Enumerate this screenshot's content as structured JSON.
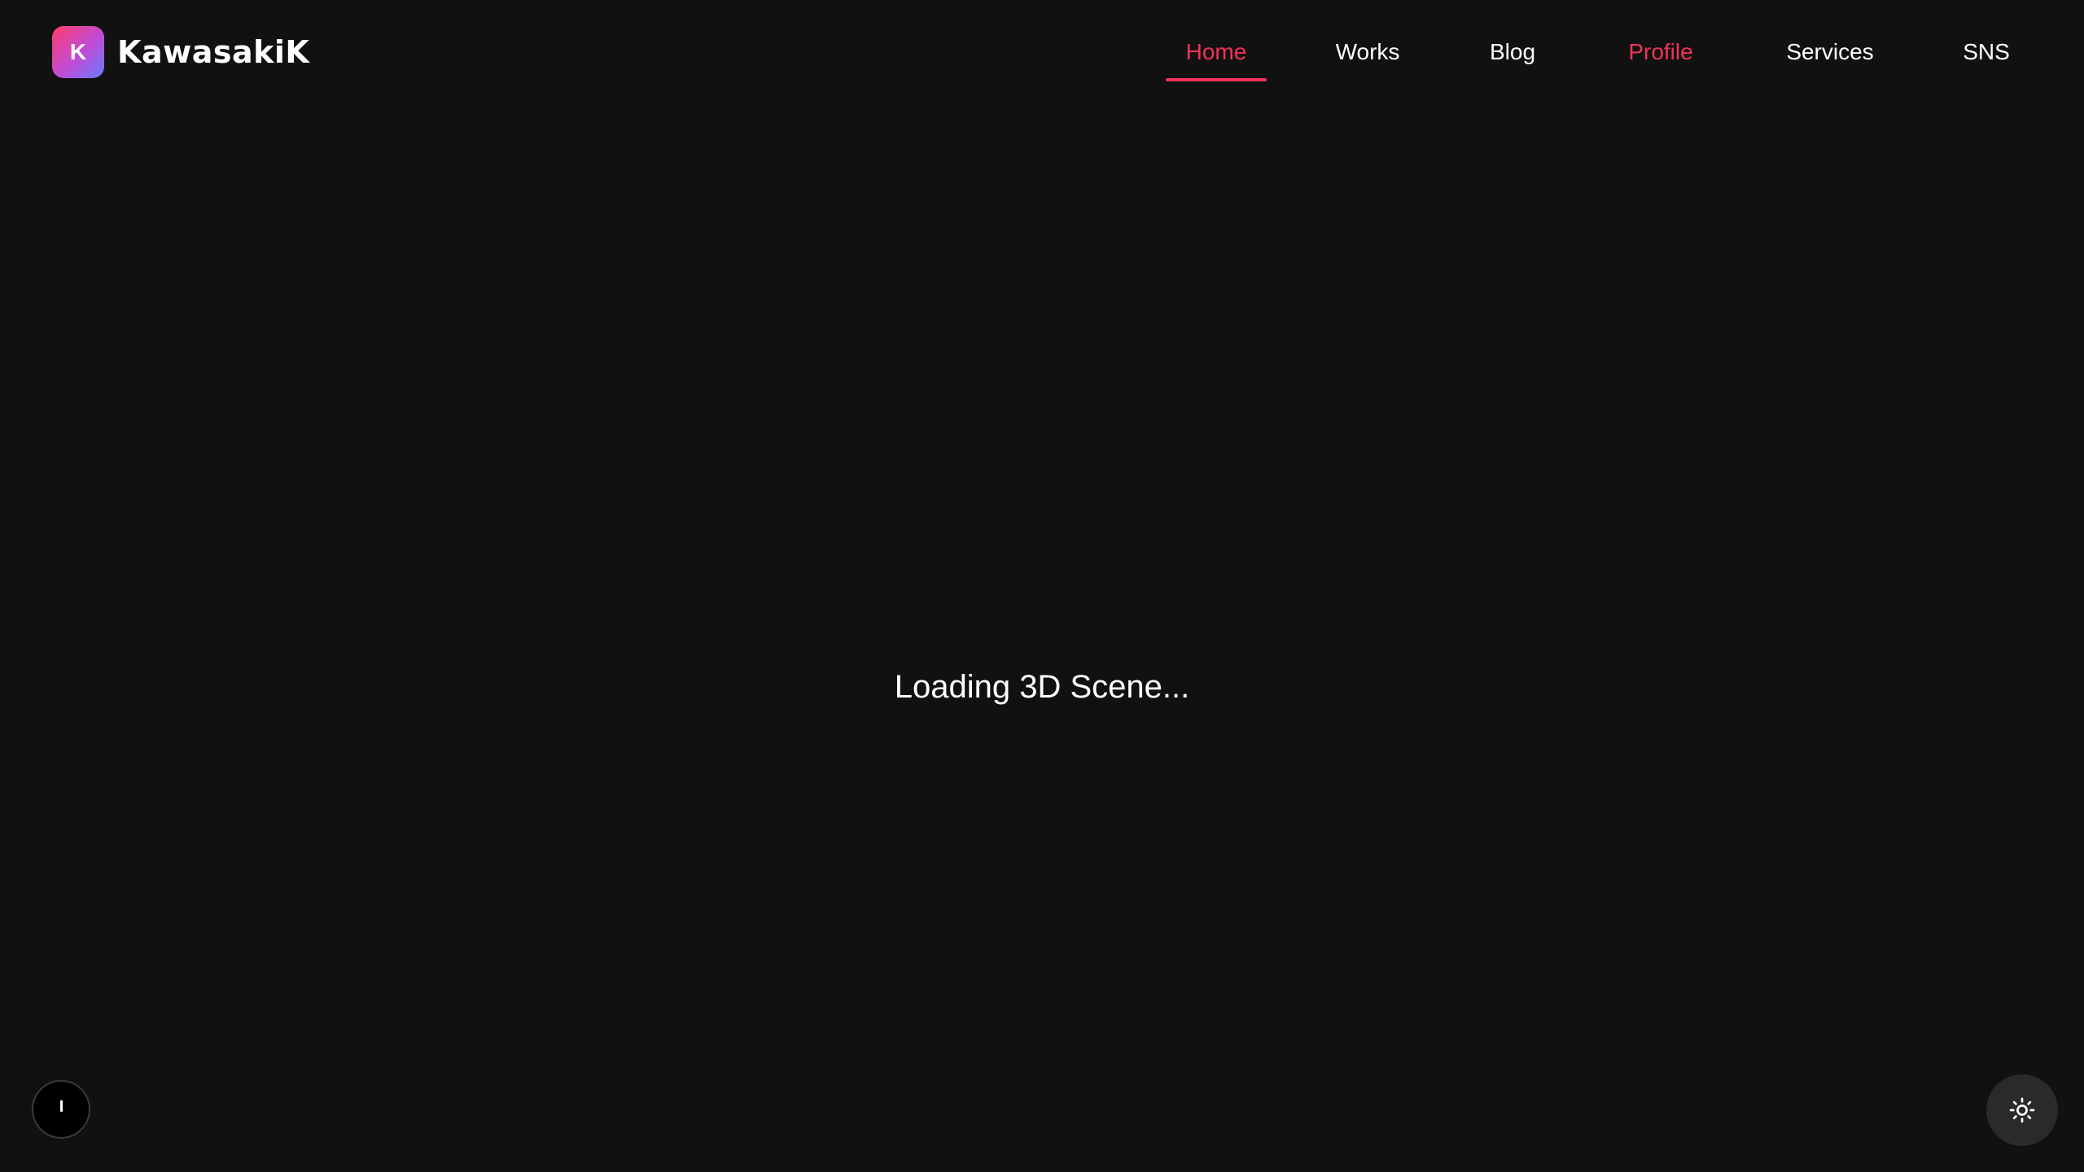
{
  "brand": {
    "badge_letter": "K",
    "name": "KawasakiK"
  },
  "nav": {
    "items": [
      {
        "label": "Home",
        "state": "active"
      },
      {
        "label": "Works",
        "state": "normal"
      },
      {
        "label": "Blog",
        "state": "normal"
      },
      {
        "label": "Profile",
        "state": "accent"
      },
      {
        "label": "Services",
        "state": "normal"
      },
      {
        "label": "SNS",
        "state": "normal"
      }
    ]
  },
  "main": {
    "loading_text": "Loading 3D Scene..."
  },
  "controls": {
    "left_button_icon": "play-indicator-icon",
    "right_button_icon": "sun-icon"
  },
  "colors": {
    "background": "#111111",
    "accent": "#f0335a",
    "text": "#ffffff"
  }
}
